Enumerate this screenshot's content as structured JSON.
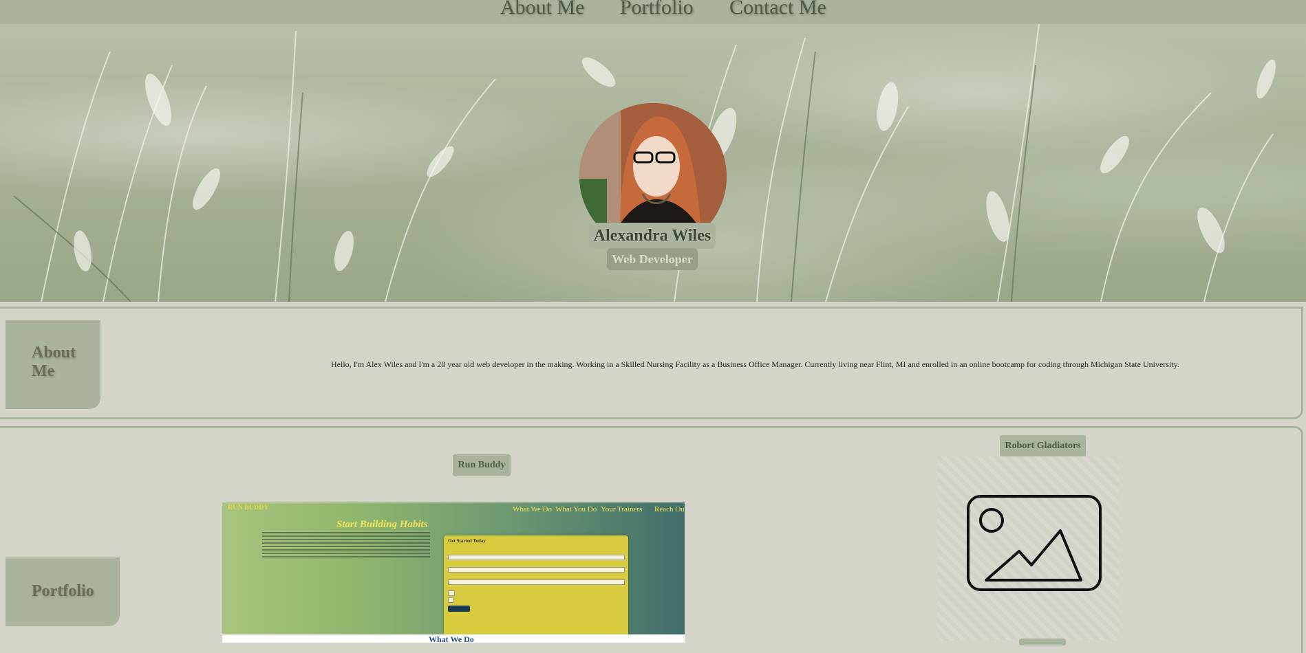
{
  "nav": {
    "about": "About Me",
    "portfolio": "Portfolio",
    "contact": "Contact Me"
  },
  "hero": {
    "name": "Alexandra Wiles",
    "title": "Web Developer"
  },
  "about": {
    "heading": "About Me",
    "text": "Hello, I'm Alex Wiles and I'm a 28 year old web developer in the making. Working in a Skilled Nursing Facility as a Business Office Manager. Currently living near Flint, MI and enrolled in an online bootcamp for coding through Michigan State University."
  },
  "portfolio": {
    "heading": "Portfolio",
    "projects": [
      {
        "label": "Run Buddy",
        "screenshot": {
          "logo": "RUN BUDDY",
          "nav": [
            "What We Do",
            "What You Do",
            "Your Trainers",
            "Reach Out"
          ],
          "headline": "Start Building Habits",
          "form_title": "Get Started Today",
          "section_heading": "What We Do"
        }
      },
      {
        "label": "Robort Gladiators",
        "image": "image-placeholder-icon"
      }
    ]
  },
  "colors": {
    "sage": "#aab39e",
    "background": "#d4d4c9",
    "text_dark": "#4f5a48"
  }
}
